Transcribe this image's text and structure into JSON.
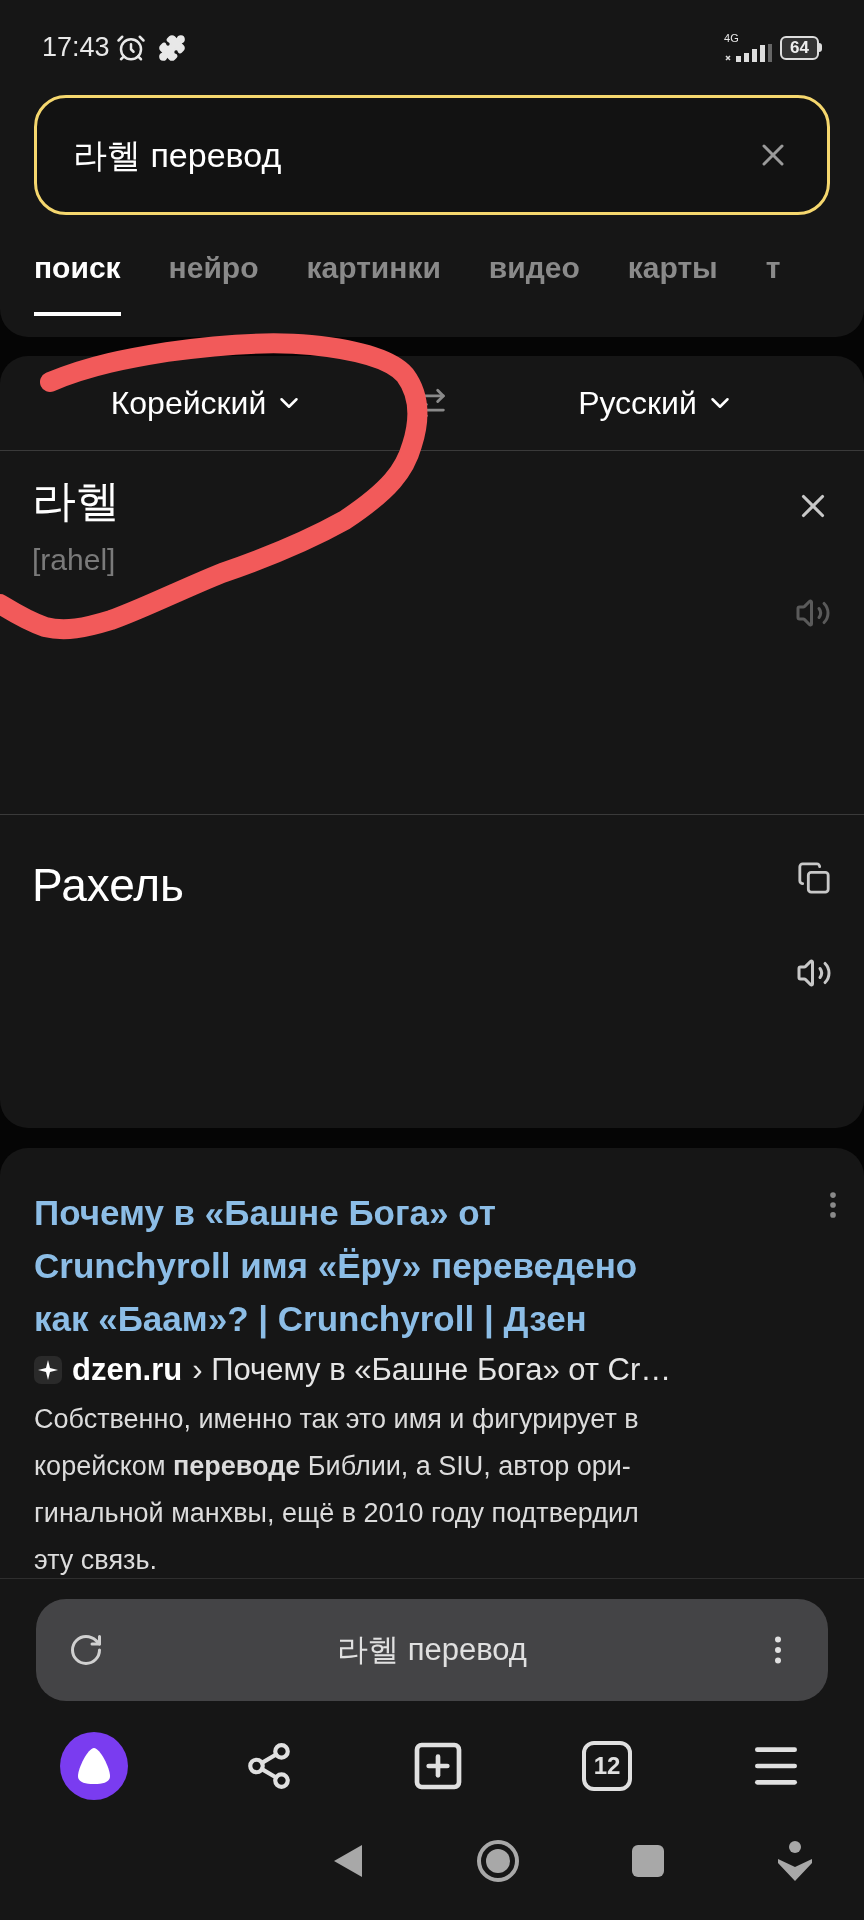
{
  "status_bar": {
    "time": "17:43",
    "network": "4G",
    "battery": "64"
  },
  "search": {
    "value": "라헬 перевод"
  },
  "tabs": [
    {
      "label": "поиск",
      "selected": true
    },
    {
      "label": "нейро",
      "selected": false
    },
    {
      "label": "картинки",
      "selected": false
    },
    {
      "label": "видео",
      "selected": false
    },
    {
      "label": "карты",
      "selected": false
    },
    {
      "label": "т",
      "selected": false
    }
  ],
  "translator": {
    "source_language": "Корейский",
    "target_language": "Русский",
    "source_text": "라헬",
    "transliteration": "[rahel]",
    "translation": "Рахель"
  },
  "result": {
    "title_lines": [
      "Почему в «Башне Бога» от",
      "Crunchyroll имя «Ёру» переведено",
      "как «Баам»? | Crunchyroll | Дзен"
    ],
    "site": "dzen.ru",
    "path": "› Почему в «Башне Бога» от Cr…",
    "snippet_lines": [
      "Собственно, именно так это имя и фигурирует в",
      "корейском **переводе** Библии, а SIU, автор ори-",
      "гинальной манхвы, ещё в 2010 году подтвердил",
      "эту связь."
    ]
  },
  "address_bar": {
    "text": "라헬 перевод"
  },
  "toolbar": {
    "tabs_count": "12"
  }
}
